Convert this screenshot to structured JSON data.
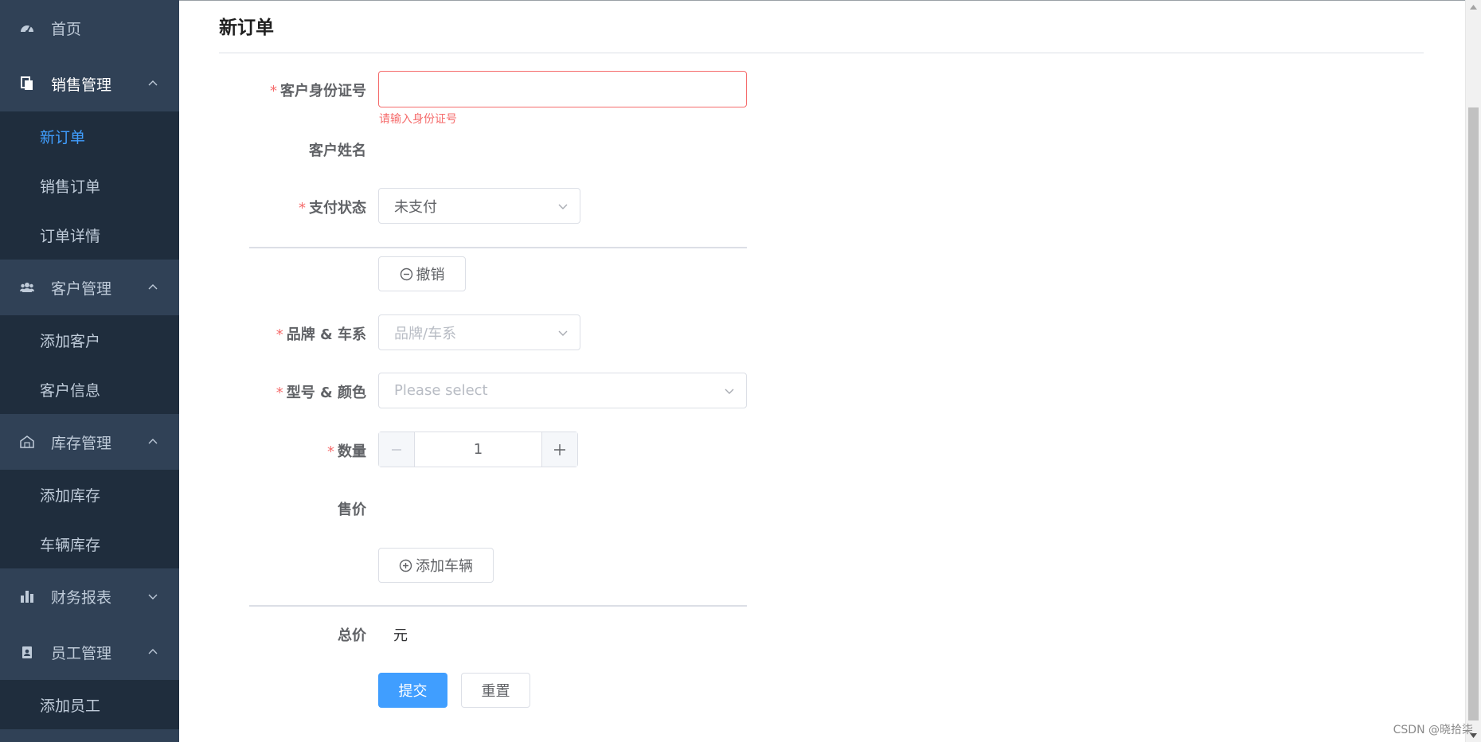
{
  "sidebar": {
    "home": {
      "label": "首页",
      "icon": "dashboard-icon"
    },
    "groups": [
      {
        "label": "销售管理",
        "icon": "documents-icon",
        "arrow": "chevron-up-icon",
        "items": [
          {
            "label": "新订单",
            "active": true
          },
          {
            "label": "销售订单"
          },
          {
            "label": "订单详情"
          }
        ]
      },
      {
        "label": "客户管理",
        "icon": "users-icon",
        "arrow": "chevron-up-icon",
        "items": [
          {
            "label": "添加客户"
          },
          {
            "label": "客户信息"
          }
        ]
      },
      {
        "label": "库存管理",
        "icon": "warehouse-icon",
        "arrow": "chevron-up-icon",
        "items": [
          {
            "label": "添加库存"
          },
          {
            "label": "车辆库存"
          }
        ]
      },
      {
        "label": "财务报表",
        "icon": "bar-chart-icon",
        "arrow": "chevron-down-icon",
        "items": []
      },
      {
        "label": "员工管理",
        "icon": "id-badge-icon",
        "arrow": "chevron-up-icon",
        "items": [
          {
            "label": "添加员工"
          }
        ]
      }
    ]
  },
  "form": {
    "title": "新订单",
    "required_mark": "*",
    "id_card": {
      "label": "客户身份证号",
      "value": "",
      "error": "请输入身份证号"
    },
    "customer_name": {
      "label": "客户姓名",
      "value": ""
    },
    "payment_status": {
      "label": "支付状态",
      "value": "未支付"
    },
    "revoke_button": "撤销",
    "brand_series": {
      "label": "品牌 & 车系",
      "placeholder": "品牌/车系"
    },
    "model_color": {
      "label": "型号 & 颜色",
      "placeholder": "Please select"
    },
    "quantity": {
      "label": "数量",
      "value": "1"
    },
    "price": {
      "label": "售价",
      "value": ""
    },
    "add_vehicle_button": "添加车辆",
    "total": {
      "label": "总价",
      "unit": "元"
    },
    "submit_button": "提交",
    "reset_button": "重置"
  },
  "watermark": "CSDN @晓拾柒",
  "colors": {
    "sidebar": "#304156",
    "submenu": "#1f2d3d",
    "accent": "#409eff",
    "error": "#f56c6c"
  }
}
